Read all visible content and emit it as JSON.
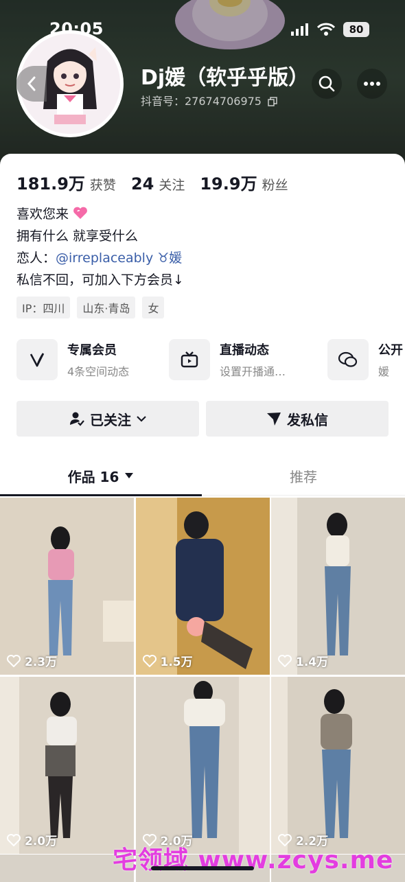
{
  "status": {
    "time": "20:05",
    "battery": "80"
  },
  "profile": {
    "nickname": "Dj媛（软乎乎版）",
    "douyin_id": "抖音号：27674706975"
  },
  "stats": [
    {
      "value": "181.9万",
      "label": "获赞"
    },
    {
      "value": "24",
      "label": "关注"
    },
    {
      "value": "19.9万",
      "label": "粉丝"
    }
  ],
  "bio": {
    "line1": "喜欢您来",
    "line2": "拥有什么  就享受什么",
    "line3_prefix": "恋人：",
    "line3_mention": "@irreplaceably ♉媛",
    "line4": "私信不回，可加入下方会员↓"
  },
  "tags": [
    "IP：四川",
    "山东·青岛",
    "女"
  ],
  "features": [
    {
      "title": "专属会员",
      "subtitle": "4条空间动态",
      "icon": "vip-v-icon"
    },
    {
      "title": "直播动态",
      "subtitle": "设置开播通…",
      "icon": "tv-icon"
    },
    {
      "title": "公开",
      "subtitle": "媛",
      "icon": "chat-bubbles-icon"
    }
  ],
  "actions": {
    "follow": "已关注",
    "message": "发私信"
  },
  "tabs": {
    "works": "作品 16",
    "recommend": "推荐"
  },
  "posts": [
    {
      "likes": "2.3万"
    },
    {
      "likes": "1.5万"
    },
    {
      "likes": "1.4万"
    },
    {
      "likes": "2.0万"
    },
    {
      "likes": "2.0万"
    },
    {
      "likes": "2.2万"
    }
  ],
  "watermark": "宅领域 www.zcys.me",
  "colors": {
    "mention": "#3a5ea8",
    "watermark": "#e33de0",
    "banner": "#2f3d34"
  }
}
